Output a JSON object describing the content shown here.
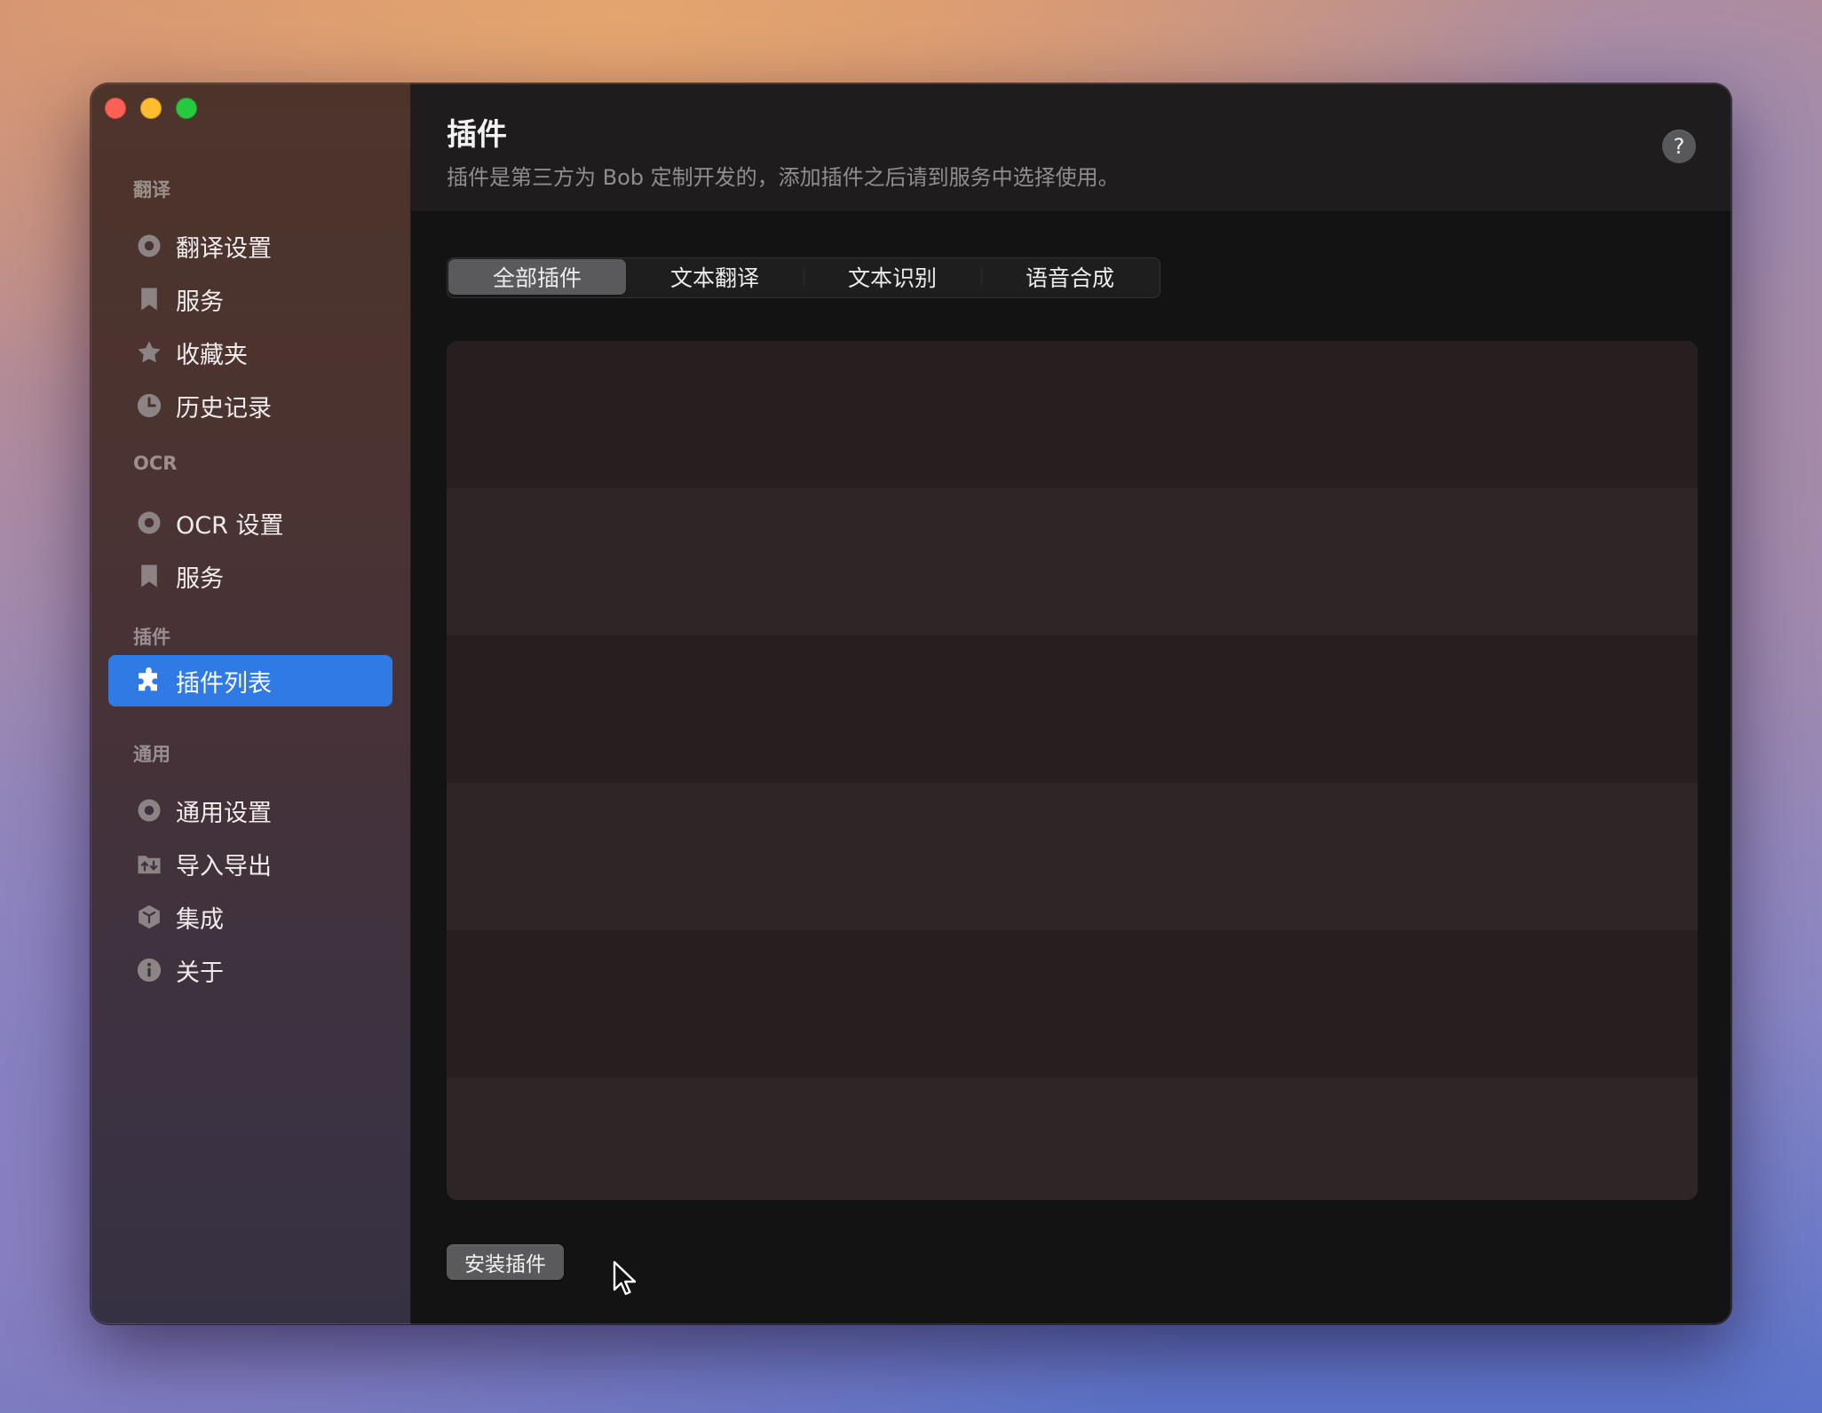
{
  "window": {
    "traffic_lights": {
      "close": "#fe5f57",
      "minimize": "#febc2e",
      "zoom": "#28c840"
    }
  },
  "sidebar": {
    "sections": [
      {
        "label": "翻译",
        "items": [
          {
            "label": "翻译设置",
            "icon": "gear-icon"
          },
          {
            "label": "服务",
            "icon": "bookmark-icon"
          },
          {
            "label": "收藏夹",
            "icon": "star-icon"
          },
          {
            "label": "历史记录",
            "icon": "clock-icon"
          }
        ]
      },
      {
        "label": "OCR",
        "items": [
          {
            "label": "OCR 设置",
            "icon": "gear-icon"
          },
          {
            "label": "服务",
            "icon": "bookmark-icon"
          }
        ]
      },
      {
        "label": "插件",
        "items": [
          {
            "label": "插件列表",
            "icon": "puzzle-icon",
            "active": true
          }
        ]
      },
      {
        "label": "通用",
        "items": [
          {
            "label": "通用设置",
            "icon": "gear-icon"
          },
          {
            "label": "导入导出",
            "icon": "folder-transfer-icon"
          },
          {
            "label": "集成",
            "icon": "cube-icon"
          },
          {
            "label": "关于",
            "icon": "info-icon"
          }
        ]
      }
    ],
    "active_color": "#2f7ae5"
  },
  "header": {
    "title": "插件",
    "subtitle": "插件是第三方为 Bob 定制开发的，添加插件之后请到服务中选择使用。",
    "help_label": "?"
  },
  "tabs": [
    {
      "label": "全部插件",
      "selected": true
    },
    {
      "label": "文本翻译",
      "selected": false
    },
    {
      "label": "文本识别",
      "selected": false
    },
    {
      "label": "语音合成",
      "selected": false
    }
  ],
  "plugin_list": {
    "rows": [
      "",
      "",
      "",
      "",
      "",
      ""
    ]
  },
  "footer": {
    "install_button": "安装插件"
  }
}
